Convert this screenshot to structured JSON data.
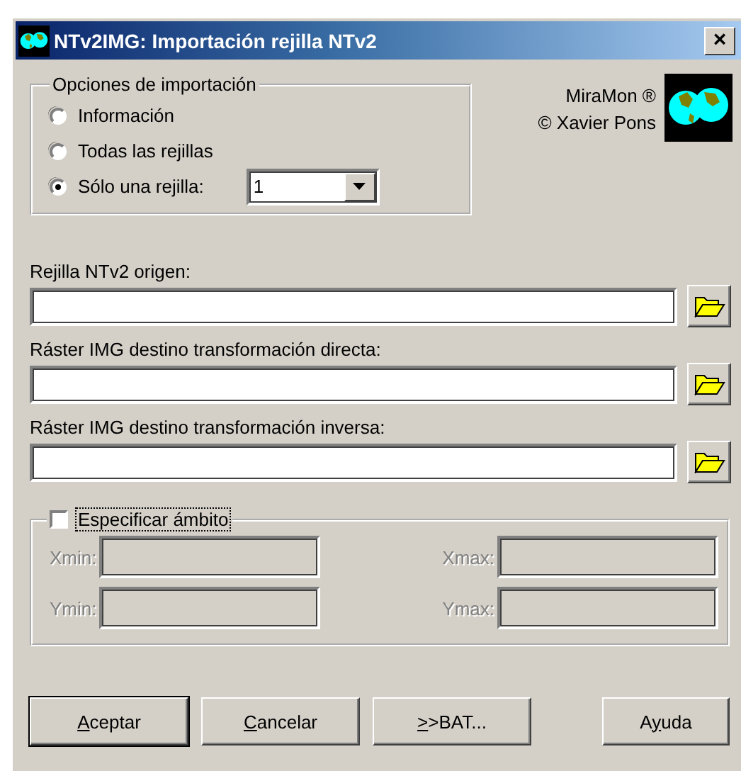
{
  "window": {
    "title": "NTv2IMG: Importación rejilla NTv2",
    "close": "×"
  },
  "import_options": {
    "legend": "Opciones de importación",
    "options": [
      {
        "label": "Información",
        "selected": false
      },
      {
        "label": "Todas las rejillas",
        "selected": false
      },
      {
        "label": "Sólo una rejilla:",
        "selected": true
      }
    ],
    "grid_select": {
      "value": "1"
    }
  },
  "credits": [
    "MiraMon ®",
    "© Xavier Pons"
  ],
  "files": [
    {
      "label": "Rejilla NTv2 origen:"
    },
    {
      "label": "Ráster IMG destino transformación directa:"
    },
    {
      "label": "Ráster IMG destino transformación inversa:"
    }
  ],
  "scope": {
    "label": "Especificar ámbito",
    "checked": false,
    "focused": true,
    "disabled": true,
    "fields": [
      {
        "label": "Xmin:"
      },
      {
        "label": "Xmax:"
      },
      {
        "label": "Ymin:"
      },
      {
        "label": "Ymax:"
      }
    ]
  },
  "buttons": [
    {
      "key": "A",
      "after": "ceptar",
      "default": true
    },
    {
      "key": "C",
      "after": "ancelar",
      "default": false
    },
    {
      "key": ">",
      "after": ">BAT...",
      "default": false
    },
    {
      "before": "A",
      "key": "y",
      "after": "uda",
      "default": false
    }
  ]
}
